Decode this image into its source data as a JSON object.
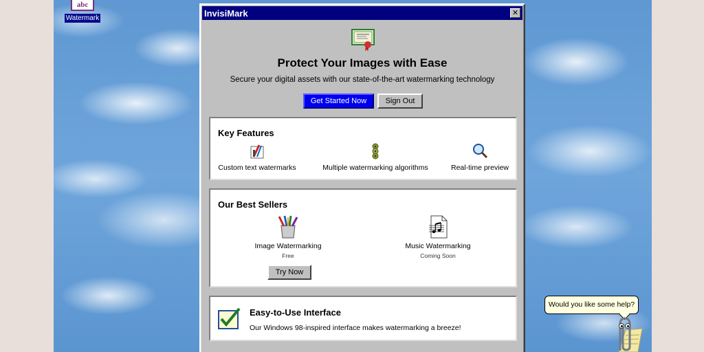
{
  "desktop": {
    "icon_label": "Watermark",
    "icon_glyph_text": "abc"
  },
  "window": {
    "title": "InvisiMark",
    "close_glyph": "✕"
  },
  "hero": {
    "icon": "certificate-icon",
    "title": "Protect Your Images with Ease",
    "subtitle": "Secure your digital assets with our state-of-the-art watermarking technology",
    "primary_button": "Get Started Now",
    "secondary_button": "Sign Out"
  },
  "features": {
    "title": "Key Features",
    "items": [
      {
        "icon": "text-tools-icon",
        "label": "Custom text watermarks"
      },
      {
        "icon": "gears-stack-icon",
        "label": "Multiple watermarking algorithms"
      },
      {
        "icon": "magnifier-icon",
        "label": "Real-time preview"
      }
    ]
  },
  "sellers": {
    "title": "Our Best Sellers",
    "items": [
      {
        "icon": "paint-brushes-icon",
        "name": "Image Watermarking",
        "price": "Free",
        "button": "Try Now"
      },
      {
        "icon": "music-file-icon",
        "name": "Music Watermarking",
        "price": "Coming Soon"
      }
    ]
  },
  "interface": {
    "icon": "checkmark-icon",
    "title": "Easy-to-Use Interface",
    "description": "Our Windows 98-inspired interface makes watermarking a breeze!"
  },
  "assistant": {
    "bubble": "Would you like some help?",
    "icon": "paperclip-assistant-icon"
  },
  "colors": {
    "titlebar": "#000080",
    "primary_button": "#0000f0",
    "window_face": "#c0c0c0",
    "help_bubble": "#ffffe1"
  }
}
